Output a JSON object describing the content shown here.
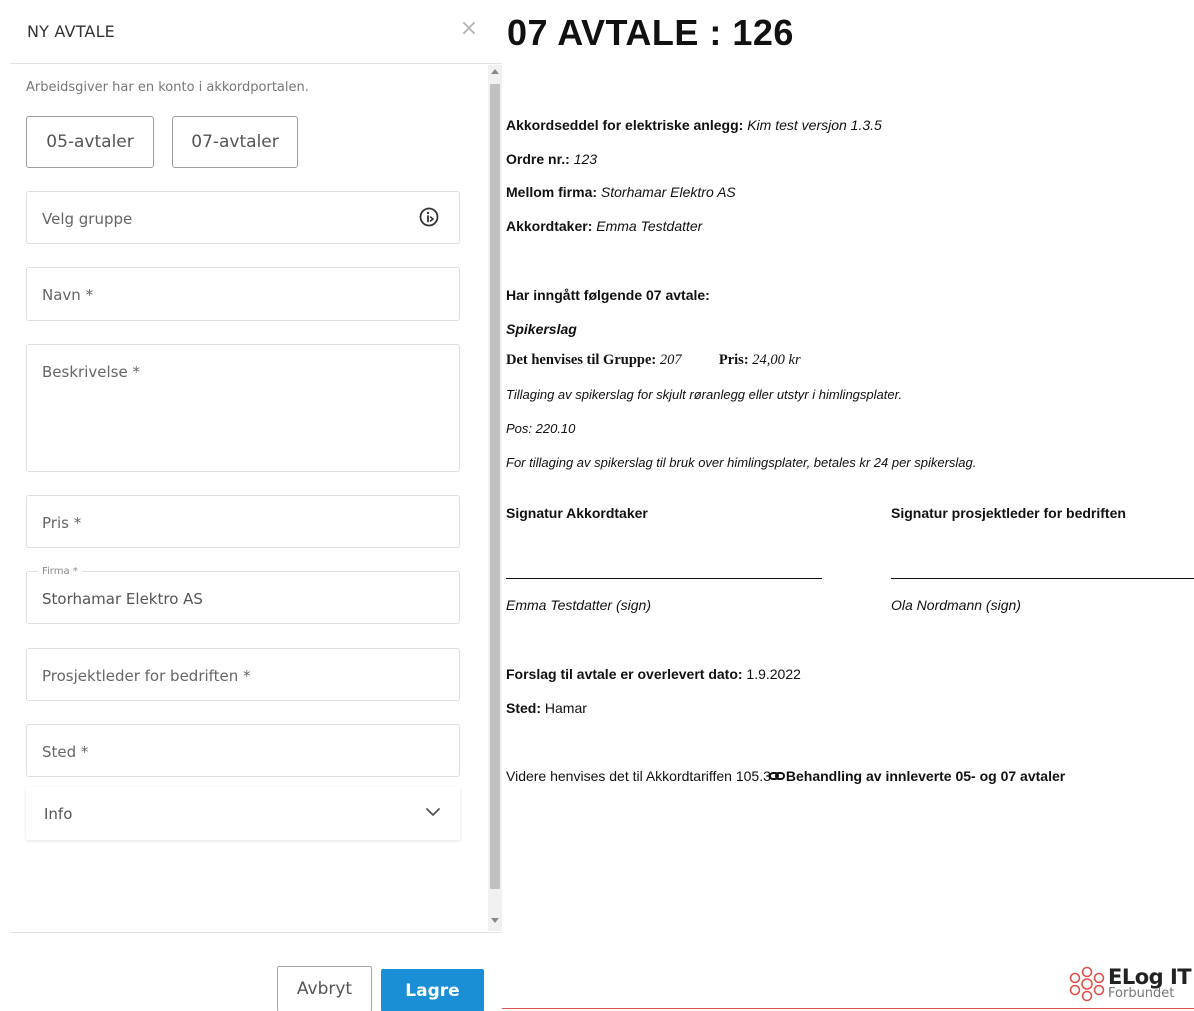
{
  "dialog": {
    "title": "NY AVTALE",
    "close_symbol": "×",
    "hint": "Arbeidsgiver har en konto i akkordportalen.",
    "type_buttons": {
      "btn_05": "05-avtaler",
      "btn_07": "07-avtaler"
    },
    "fields": {
      "gruppe_placeholder": "Velg gruppe",
      "navn_placeholder": "Navn *",
      "beskrivelse_placeholder": "Beskrivelse *",
      "pris_placeholder": "Pris *",
      "firma_label": "Firma *",
      "firma_value": "Storhamar Elektro AS",
      "prosjektleder_placeholder": "Prosjektleder for bedriften *",
      "sted_placeholder": "Sted *"
    },
    "info_section": {
      "title": "Info"
    },
    "footer": {
      "cancel_label": "Avbryt",
      "save_label": "Lagre"
    },
    "icons": {
      "gruppe_info": "info-circle-icon",
      "info_toggle": "chevron-down-icon",
      "close": "close-icon"
    }
  },
  "document": {
    "title": "07 AVTALE : 126",
    "akkordseddel_label": "Akkordseddel for elektriske anlegg:",
    "akkordseddel_value": "Kim test versjon 1.3.5",
    "ordre_label": "Ordre nr.:",
    "ordre_value": "123",
    "mellom_label": "Mellom firma:",
    "mellom_value": "Storhamar Elektro AS",
    "akkordtaker_label": "Akkordtaker:",
    "akkordtaker_value": "Emma Testdatter",
    "agreement_heading": "Har inngått følgende 07 avtale:",
    "item_name": "Spikerslag",
    "gruppe_label": "Det henvises til Gruppe:",
    "gruppe_value": "207",
    "pris_label": "Pris:",
    "pris_value": "24,00 kr",
    "description": "Tillaging av spikerslag for skjult røranlegg eller utstyr i himlingsplater.",
    "pos": "Pos: 220.10",
    "note": "For tillaging av spikerslag til bruk over himlingsplater, betales kr 24 per spikerslag.",
    "sig_left_title": "Signatur Akkordtaker",
    "sig_right_title": "Signatur prosjektleder for bedriften",
    "sig_left_name": "Emma Testdatter (sign)",
    "sig_right_name": "Ola Nordmann (sign)",
    "delivered_label": "Forslag til avtale er overlevert dato:",
    "delivered_value": "1.9.2022",
    "sted_label": "Sted:",
    "sted_value": "Hamar",
    "reference_text": "Videre henvises det til Akkordtariffen 105.3",
    "reference_link": "Behandling av innleverte 05- og 07 avtaler",
    "logo_main": "ELog IT",
    "logo_sub": "Forbundet",
    "accent_color": "#e0524a",
    "primary_color": "#1a8fd6"
  }
}
